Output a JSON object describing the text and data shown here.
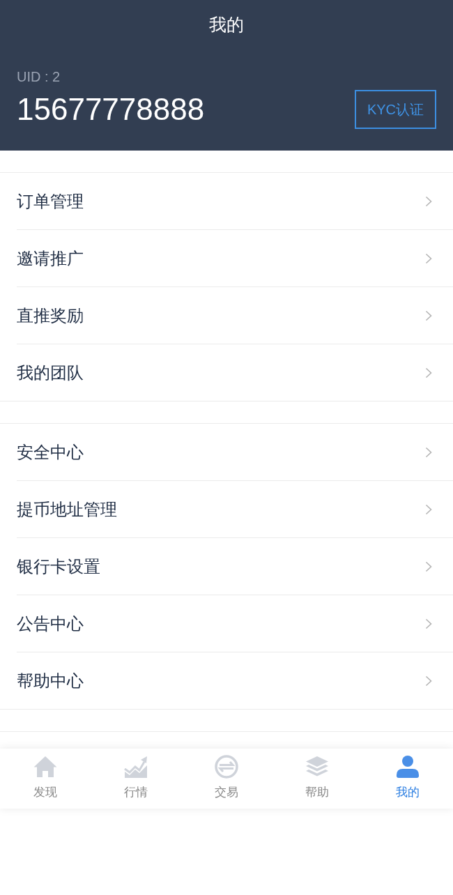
{
  "header": {
    "title": "我的",
    "uid": "UID : 2",
    "phone": "15677778888",
    "kyc_button": "KYC认证"
  },
  "menu_groups": [
    {
      "items": [
        {
          "label": "订单管理"
        },
        {
          "label": "邀请推广"
        },
        {
          "label": "直推奖励"
        },
        {
          "label": "我的团队"
        }
      ]
    },
    {
      "items": [
        {
          "label": "安全中心"
        },
        {
          "label": "提币地址管理"
        },
        {
          "label": "银行卡设置"
        },
        {
          "label": "公告中心"
        },
        {
          "label": "帮助中心"
        }
      ]
    }
  ],
  "tab_bar": [
    {
      "label": "发现",
      "kind": "home",
      "selected": false
    },
    {
      "label": "行情",
      "kind": "chart",
      "selected": false
    },
    {
      "label": "交易",
      "kind": "exchange",
      "selected": false
    },
    {
      "label": "帮助",
      "kind": "layers",
      "selected": false
    },
    {
      "label": "我的",
      "kind": "person",
      "selected": true
    }
  ]
}
